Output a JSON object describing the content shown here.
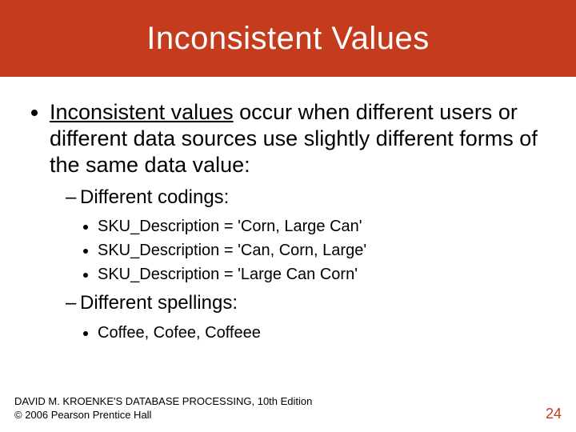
{
  "title": "Inconsistent Values",
  "bullet_lead": "Inconsistent values",
  "bullet_rest": " occur when different users or different data sources use slightly different forms of the same data value:",
  "sub1": {
    "label": "Different codings:",
    "items": [
      "SKU_Description = 'Corn, Large Can'",
      "SKU_Description = 'Can, Corn, Large'",
      "SKU_Description = 'Large Can Corn'"
    ]
  },
  "sub2": {
    "label": "Different spellings:",
    "items": [
      "Coffee, Cofee, Coffeee"
    ]
  },
  "footer_line1": "DAVID M. KROENKE'S DATABASE PROCESSING, 10th Edition",
  "footer_line2": "© 2006 Pearson Prentice Hall",
  "page_number": "24"
}
